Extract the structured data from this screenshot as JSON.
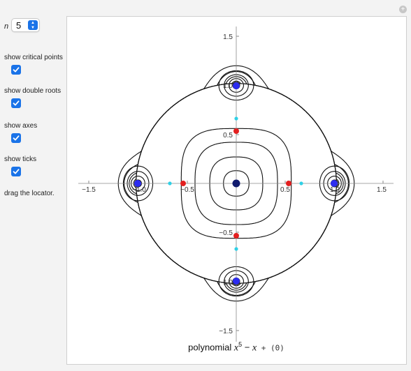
{
  "controls": {
    "n_label": "n",
    "n_value": "5",
    "show_critical_points": {
      "label": "show critical points",
      "checked": true
    },
    "show_double_roots": {
      "label": "show double roots",
      "checked": true
    },
    "show_axes": {
      "label": "show axes",
      "checked": true
    },
    "show_ticks": {
      "label": "show ticks",
      "checked": true
    },
    "hint": "drag the locator."
  },
  "plot": {
    "x_ticks": [
      "−1.5",
      "−1.0",
      "−0.5",
      "0.5",
      "1.0",
      "1.5"
    ],
    "y_ticks": [
      "1.5",
      "1.0",
      "0.5",
      "−0.5",
      "−1.0",
      "−1.5"
    ],
    "caption_prefix": "polynomial",
    "caption_poly_a": "x",
    "caption_exp": "5",
    "caption_minus": " − ",
    "caption_poly_b": "x",
    "caption_plus": " + ",
    "caption_param": "(0)",
    "colors": {
      "contour": "#111111",
      "critical_point": "#e32020",
      "double_root": "#2c2cf0",
      "minor_point": "#2fd0e6",
      "locator": "#101a6e"
    }
  }
}
